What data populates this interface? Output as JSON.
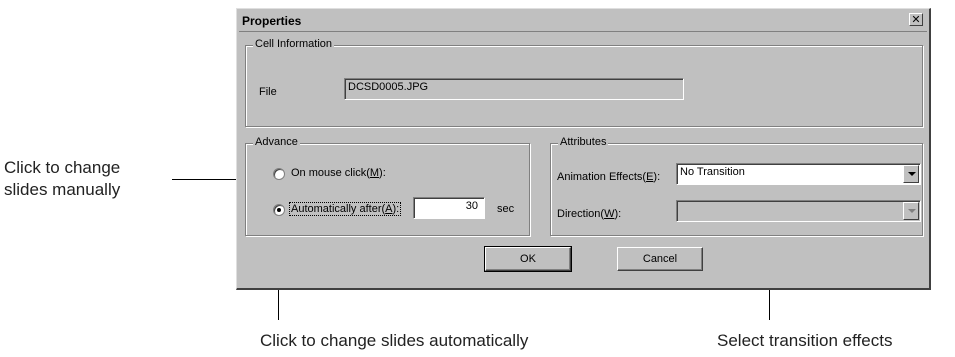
{
  "callouts": {
    "manual_line1": "Click to change",
    "manual_line2": "slides manually",
    "automatic": "Click to change slides automatically",
    "transition": "Select transition effects"
  },
  "dialog": {
    "title": "Properties",
    "close_glyph": "✕",
    "cell_info": {
      "legend": "Cell Information",
      "file_label": "File",
      "file_value": "DCSD0005.JPG"
    },
    "advance": {
      "legend": "Advance",
      "mouse_click_label": "On mouse click(",
      "mouse_click_key": "M",
      "mouse_click_suffix": "):",
      "auto_label": "Automatically after(",
      "auto_key": "A",
      "auto_suffix": "):",
      "auto_value": "30",
      "auto_unit": "sec",
      "selected": "automatic"
    },
    "attributes": {
      "legend": "Attributes",
      "animation_label": "Animation Effects(",
      "animation_key": "E",
      "animation_suffix": "):",
      "animation_value": "No Transition",
      "direction_label": "Direction(",
      "direction_key": "W",
      "direction_suffix": "):",
      "direction_value": ""
    },
    "buttons": {
      "ok": "OK",
      "cancel": "Cancel"
    }
  },
  "colors": {
    "dialog_face": "#c0c0c0",
    "shadow": "#808080",
    "highlight": "#ffffff"
  }
}
